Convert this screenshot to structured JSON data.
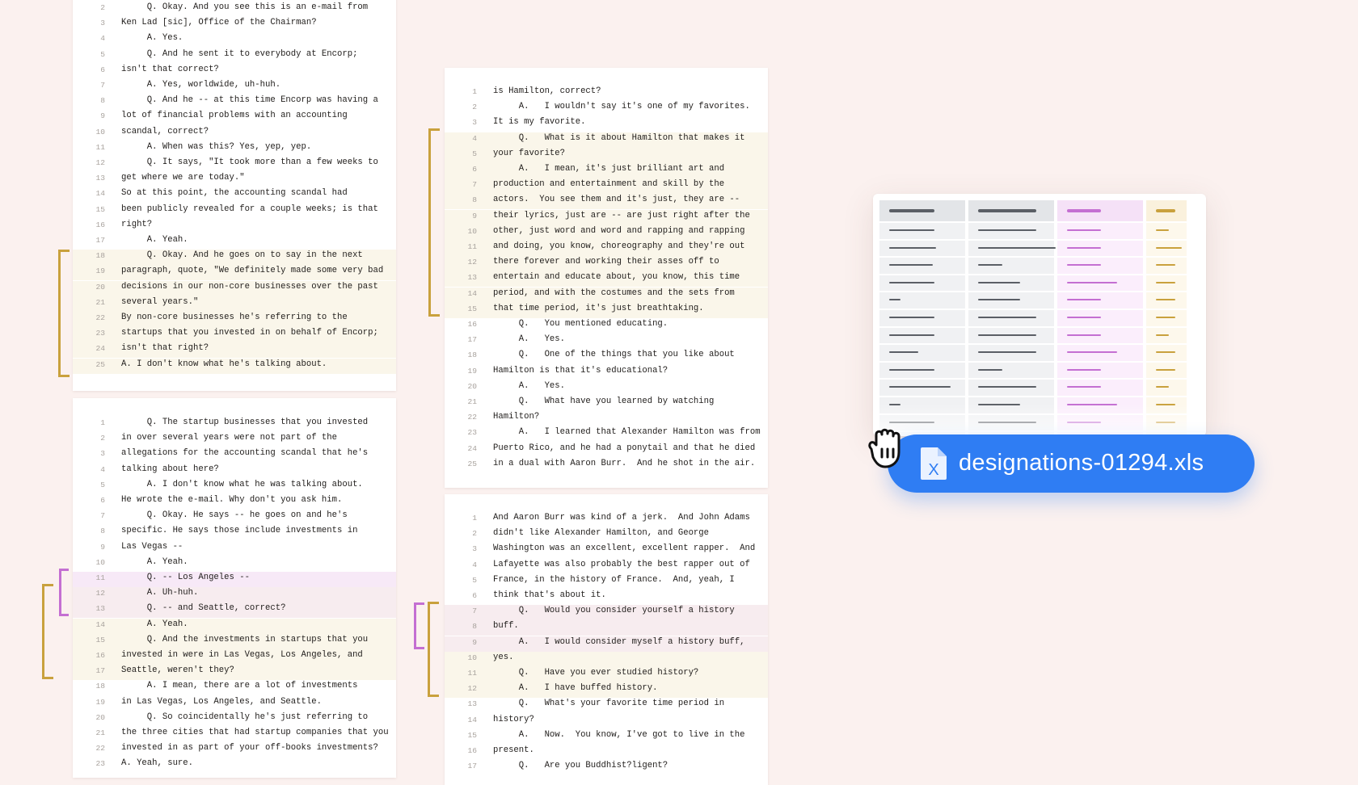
{
  "page_a": {
    "lines": [
      {
        "n": "2",
        "t": "     Q. Okay. And you see this is an e-mail from",
        "hl": ""
      },
      {
        "n": "3",
        "t": "Ken Lad [sic], Office of the Chairman?",
        "hl": ""
      },
      {
        "n": "4",
        "t": "     A. Yes.",
        "hl": ""
      },
      {
        "n": "5",
        "t": "     Q. And he sent it to everybody at Encorp;",
        "hl": ""
      },
      {
        "n": "6",
        "t": "isn't that correct?",
        "hl": ""
      },
      {
        "n": "7",
        "t": "     A. Yes, worldwide, uh-huh.",
        "hl": ""
      },
      {
        "n": "8",
        "t": "     Q. And he -- at this time Encorp was having a",
        "hl": ""
      },
      {
        "n": "9",
        "t": "lot of financial problems with an accounting",
        "hl": ""
      },
      {
        "n": "10",
        "t": "scandal, correct?",
        "hl": ""
      },
      {
        "n": "11",
        "t": "     A. When was this? Yes, yep, yep.",
        "hl": ""
      },
      {
        "n": "12",
        "t": "     Q. It says, \"It took more than a few weeks to",
        "hl": ""
      },
      {
        "n": "13",
        "t": "get where we are today.\"",
        "hl": ""
      },
      {
        "n": "14",
        "t": "So at this point, the accounting scandal had",
        "hl": ""
      },
      {
        "n": "15",
        "t": "been publicly revealed for a couple weeks; is that",
        "hl": ""
      },
      {
        "n": "16",
        "t": "right?",
        "hl": ""
      },
      {
        "n": "17",
        "t": "     A. Yeah.",
        "hl": ""
      },
      {
        "n": "18",
        "t": "     Q. Okay. And he goes on to say in the next",
        "hl": "yellow"
      },
      {
        "n": "19",
        "t": "paragraph, quote, \"We definitely made some very bad",
        "hl": "yellow"
      },
      {
        "n": "20",
        "t": "decisions in our non-core businesses over the past",
        "hl": "yellow"
      },
      {
        "n": "21",
        "t": "several years.\"",
        "hl": "yellow"
      },
      {
        "n": "22",
        "t": "By non-core businesses he's referring to the",
        "hl": "yellow"
      },
      {
        "n": "23",
        "t": "startups that you invested in on behalf of Encorp;",
        "hl": "yellow"
      },
      {
        "n": "24",
        "t": "isn't that right?",
        "hl": "yellow"
      },
      {
        "n": "25",
        "t": "A. I don't know what he's talking about.",
        "hl": "yellow"
      }
    ]
  },
  "page_b": {
    "lines": [
      {
        "n": "1",
        "t": "     Q. The startup businesses that you invested",
        "hl": ""
      },
      {
        "n": "2",
        "t": "in over several years were not part of the",
        "hl": ""
      },
      {
        "n": "3",
        "t": "allegations for the accounting scandal that he's",
        "hl": ""
      },
      {
        "n": "4",
        "t": "talking about here?",
        "hl": ""
      },
      {
        "n": "5",
        "t": "     A. I don't know what he was talking about.",
        "hl": ""
      },
      {
        "n": "6",
        "t": "He wrote the e-mail. Why don't you ask him.",
        "hl": ""
      },
      {
        "n": "7",
        "t": "     Q. Okay. He says -- he goes on and he's",
        "hl": ""
      },
      {
        "n": "8",
        "t": "specific. He says those include investments in",
        "hl": ""
      },
      {
        "n": "9",
        "t": "Las Vegas --",
        "hl": ""
      },
      {
        "n": "10",
        "t": "     A. Yeah.",
        "hl": ""
      },
      {
        "n": "11",
        "t": "     Q. -- Los Angeles --",
        "hl": "purple"
      },
      {
        "n": "12",
        "t": "     A. Uh-huh.",
        "hl": "mix"
      },
      {
        "n": "13",
        "t": "     Q. -- and Seattle, correct?",
        "hl": "mix"
      },
      {
        "n": "14",
        "t": "     A. Yeah.",
        "hl": "yellow"
      },
      {
        "n": "15",
        "t": "     Q. And the investments in startups that you",
        "hl": "yellow"
      },
      {
        "n": "16",
        "t": "invested in were in Las Vegas, Los Angeles, and",
        "hl": "yellow"
      },
      {
        "n": "17",
        "t": "Seattle, weren't they?",
        "hl": "yellow"
      },
      {
        "n": "18",
        "t": "     A. I mean, there are a lot of investments",
        "hl": ""
      },
      {
        "n": "19",
        "t": "in Las Vegas, Los Angeles, and Seattle.",
        "hl": ""
      },
      {
        "n": "20",
        "t": "     Q. So coincidentally he's just referring to",
        "hl": ""
      },
      {
        "n": "21",
        "t": "the three cities that had startup companies that you",
        "hl": ""
      },
      {
        "n": "22",
        "t": "invested in as part of your off-books investments?",
        "hl": ""
      },
      {
        "n": "23",
        "t": "A. Yeah, sure.",
        "hl": ""
      }
    ]
  },
  "page_c": {
    "lines": [
      {
        "n": "1",
        "t": "is Hamilton, correct?",
        "hl": ""
      },
      {
        "n": "2",
        "t": "     A.   I wouldn't say it's one of my favorites.",
        "hl": ""
      },
      {
        "n": "3",
        "t": "It is my favorite.",
        "hl": ""
      },
      {
        "n": "4",
        "t": "     Q.   What is it about Hamilton that makes it",
        "hl": "yellow"
      },
      {
        "n": "5",
        "t": "your favorite?",
        "hl": "yellow"
      },
      {
        "n": "6",
        "t": "     A.   I mean, it's just brilliant art and",
        "hl": "yellow"
      },
      {
        "n": "7",
        "t": "production and entertainment and skill by the",
        "hl": "yellow"
      },
      {
        "n": "8",
        "t": "actors.  You see them and it's just, they are --",
        "hl": "yellow"
      },
      {
        "n": "9",
        "t": "their lyrics, just are -- are just right after the",
        "hl": "yellow"
      },
      {
        "n": "10",
        "t": "other, just word and word and rapping and rapping",
        "hl": "yellow"
      },
      {
        "n": "11",
        "t": "and doing, you know, choreography and they're out",
        "hl": "yellow"
      },
      {
        "n": "12",
        "t": "there forever and working their asses off to",
        "hl": "yellow"
      },
      {
        "n": "13",
        "t": "entertain and educate about, you know, this time",
        "hl": "yellow"
      },
      {
        "n": "14",
        "t": "period, and with the costumes and the sets from",
        "hl": "yellow"
      },
      {
        "n": "15",
        "t": "that time period, it's just breathtaking.",
        "hl": "yellow"
      },
      {
        "n": "16",
        "t": "     Q.   You mentioned educating.",
        "hl": ""
      },
      {
        "n": "17",
        "t": "     A.   Yes.",
        "hl": ""
      },
      {
        "n": "18",
        "t": "     Q.   One of the things that you like about",
        "hl": ""
      },
      {
        "n": "19",
        "t": "Hamilton is that it's educational?",
        "hl": ""
      },
      {
        "n": "20",
        "t": "     A.   Yes.",
        "hl": ""
      },
      {
        "n": "21",
        "t": "     Q.   What have you learned by watching",
        "hl": ""
      },
      {
        "n": "22",
        "t": "Hamilton?",
        "hl": ""
      },
      {
        "n": "23",
        "t": "     A.   I learned that Alexander Hamilton was from",
        "hl": ""
      },
      {
        "n": "24",
        "t": "Puerto Rico, and he had a ponytail and that he died",
        "hl": ""
      },
      {
        "n": "25",
        "t": "in a dual with Aaron Burr.  And he shot in the air.",
        "hl": ""
      }
    ]
  },
  "page_d": {
    "lines": [
      {
        "n": "1",
        "t": "And Aaron Burr was kind of a jerk.  And John Adams",
        "hl": ""
      },
      {
        "n": "2",
        "t": "didn't like Alexander Hamilton, and George",
        "hl": ""
      },
      {
        "n": "3",
        "t": "Washington was an excellent, excellent rapper.  And",
        "hl": ""
      },
      {
        "n": "4",
        "t": "Lafayette was also probably the best rapper out of",
        "hl": ""
      },
      {
        "n": "5",
        "t": "France, in the history of France.  And, yeah, I",
        "hl": ""
      },
      {
        "n": "6",
        "t": "think that's about it.",
        "hl": ""
      },
      {
        "n": "7",
        "t": "     Q.   Would you consider yourself a history",
        "hl": "mix"
      },
      {
        "n": "8",
        "t": "buff.",
        "hl": "mix"
      },
      {
        "n": "9",
        "t": "     A.   I would consider myself a history buff,",
        "hl": "mix"
      },
      {
        "n": "10",
        "t": "yes.",
        "hl": "yellow"
      },
      {
        "n": "11",
        "t": "     Q.   Have you ever studied history?",
        "hl": "yellow"
      },
      {
        "n": "12",
        "t": "     A.   I have buffed history.",
        "hl": "yellow"
      },
      {
        "n": "13",
        "t": "     Q.   What's your favorite time period in",
        "hl": ""
      },
      {
        "n": "14",
        "t": "history?",
        "hl": ""
      },
      {
        "n": "15",
        "t": "     A.   Now.  You know, I've got to live in the",
        "hl": ""
      },
      {
        "n": "16",
        "t": "present.",
        "hl": ""
      },
      {
        "n": "17",
        "t": "     Q.   Are you Buddhist?ligent?",
        "hl": ""
      }
    ]
  },
  "file_pill": {
    "filename": "designations-01294.xls",
    "icon": "excel-file-icon",
    "cursor_icon": "grab-hand-icon"
  },
  "colors": {
    "gold": "#c9a13d",
    "purple": "#c46fd2",
    "blue": "#2f7df3"
  }
}
